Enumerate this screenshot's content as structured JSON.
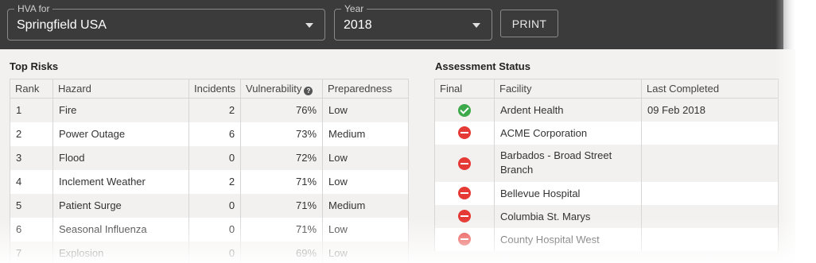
{
  "header": {
    "hva_label": "HVA for",
    "hva_value": "Springfield USA",
    "year_label": "Year",
    "year_value": "2018",
    "print_label": "PRINT"
  },
  "top_risks": {
    "title": "Top Risks",
    "columns": [
      "Rank",
      "Hazard",
      "Incidents",
      "Vulnerability",
      "Preparedness"
    ],
    "rows": [
      {
        "rank": "1",
        "hazard": "Fire",
        "incidents": "2",
        "vulnerability": "76%",
        "preparedness": "Low"
      },
      {
        "rank": "2",
        "hazard": "Power Outage",
        "incidents": "6",
        "vulnerability": "73%",
        "preparedness": "Medium"
      },
      {
        "rank": "3",
        "hazard": "Flood",
        "incidents": "0",
        "vulnerability": "72%",
        "preparedness": "Low"
      },
      {
        "rank": "4",
        "hazard": "Inclement Weather",
        "incidents": "2",
        "vulnerability": "71%",
        "preparedness": "Low"
      },
      {
        "rank": "5",
        "hazard": "Patient Surge",
        "incidents": "0",
        "vulnerability": "71%",
        "preparedness": "Medium"
      },
      {
        "rank": "6",
        "hazard": "Seasonal Influenza",
        "incidents": "0",
        "vulnerability": "71%",
        "preparedness": "Low"
      },
      {
        "rank": "7",
        "hazard": "Explosion",
        "incidents": "0",
        "vulnerability": "69%",
        "preparedness": "Low"
      }
    ]
  },
  "assessment_status": {
    "title": "Assessment Status",
    "columns": [
      "Final",
      "Facility",
      "Last Completed"
    ],
    "rows": [
      {
        "status": "complete",
        "icon": "check-circle-icon",
        "facility": "Ardent Health",
        "last_completed": "09 Feb 2018"
      },
      {
        "status": "incomplete",
        "icon": "no-entry-icon",
        "facility": "ACME Corporation",
        "last_completed": ""
      },
      {
        "status": "incomplete",
        "icon": "no-entry-icon",
        "facility": "Barbados - Broad Street Branch",
        "last_completed": ""
      },
      {
        "status": "incomplete",
        "icon": "no-entry-icon",
        "facility": "Bellevue Hospital",
        "last_completed": ""
      },
      {
        "status": "incomplete",
        "icon": "no-entry-icon",
        "facility": "Columbia St. Marys",
        "last_completed": ""
      },
      {
        "status": "incomplete",
        "icon": "no-entry-icon",
        "facility": "County Hospital West",
        "last_completed": ""
      }
    ]
  },
  "colors": {
    "header_bg": "#3b3b3b",
    "content_bg": "#f2f1ef",
    "status_complete": "#3ca94b",
    "status_incomplete": "#e53935"
  }
}
